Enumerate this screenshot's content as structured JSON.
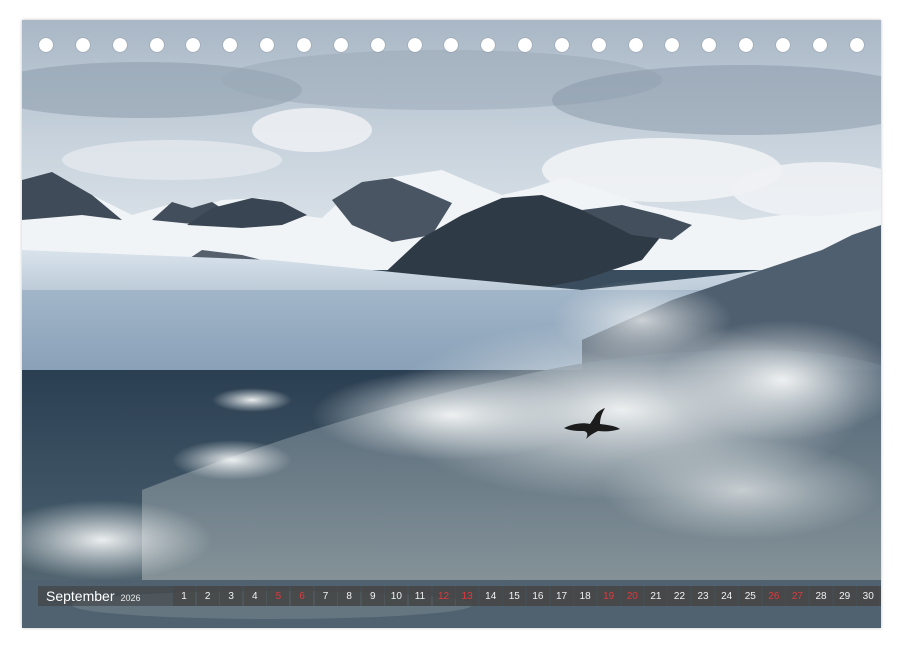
{
  "calendar": {
    "month": "September",
    "year": "2026",
    "days": [
      {
        "num": "1",
        "weekend": false
      },
      {
        "num": "2",
        "weekend": false
      },
      {
        "num": "3",
        "weekend": false
      },
      {
        "num": "4",
        "weekend": false
      },
      {
        "num": "5",
        "weekend": true
      },
      {
        "num": "6",
        "weekend": true
      },
      {
        "num": "7",
        "weekend": false
      },
      {
        "num": "8",
        "weekend": false
      },
      {
        "num": "9",
        "weekend": false
      },
      {
        "num": "10",
        "weekend": false
      },
      {
        "num": "11",
        "weekend": false
      },
      {
        "num": "12",
        "weekend": true
      },
      {
        "num": "13",
        "weekend": true
      },
      {
        "num": "14",
        "weekend": false
      },
      {
        "num": "15",
        "weekend": false
      },
      {
        "num": "16",
        "weekend": false
      },
      {
        "num": "17",
        "weekend": false
      },
      {
        "num": "18",
        "weekend": false
      },
      {
        "num": "19",
        "weekend": true
      },
      {
        "num": "20",
        "weekend": true
      },
      {
        "num": "21",
        "weekend": false
      },
      {
        "num": "22",
        "weekend": false
      },
      {
        "num": "23",
        "weekend": false
      },
      {
        "num": "24",
        "weekend": false
      },
      {
        "num": "25",
        "weekend": false
      },
      {
        "num": "26",
        "weekend": true
      },
      {
        "num": "27",
        "weekend": true
      },
      {
        "num": "28",
        "weekend": false
      },
      {
        "num": "29",
        "weekend": false
      },
      {
        "num": "30",
        "weekend": false
      }
    ]
  },
  "photo": {
    "subject": "Arctic glacier mountains with breaking ocean wave and flying seabird",
    "colors": {
      "sky_top": "#b9c6d3",
      "cloud": "#eef1f4",
      "mountain_snow": "#f2f5f8",
      "mountain_rock": "#3c4754",
      "glacier": "#9fb4c9",
      "sea_dark": "#28394a",
      "sea_mid": "#4f6473",
      "spray": "#e9ecec",
      "bird": "#1c1c1c"
    }
  },
  "binding": {
    "hole_count": 23
  },
  "style": {
    "weekend_color": "#e0393c",
    "strip_color": "#464646"
  }
}
